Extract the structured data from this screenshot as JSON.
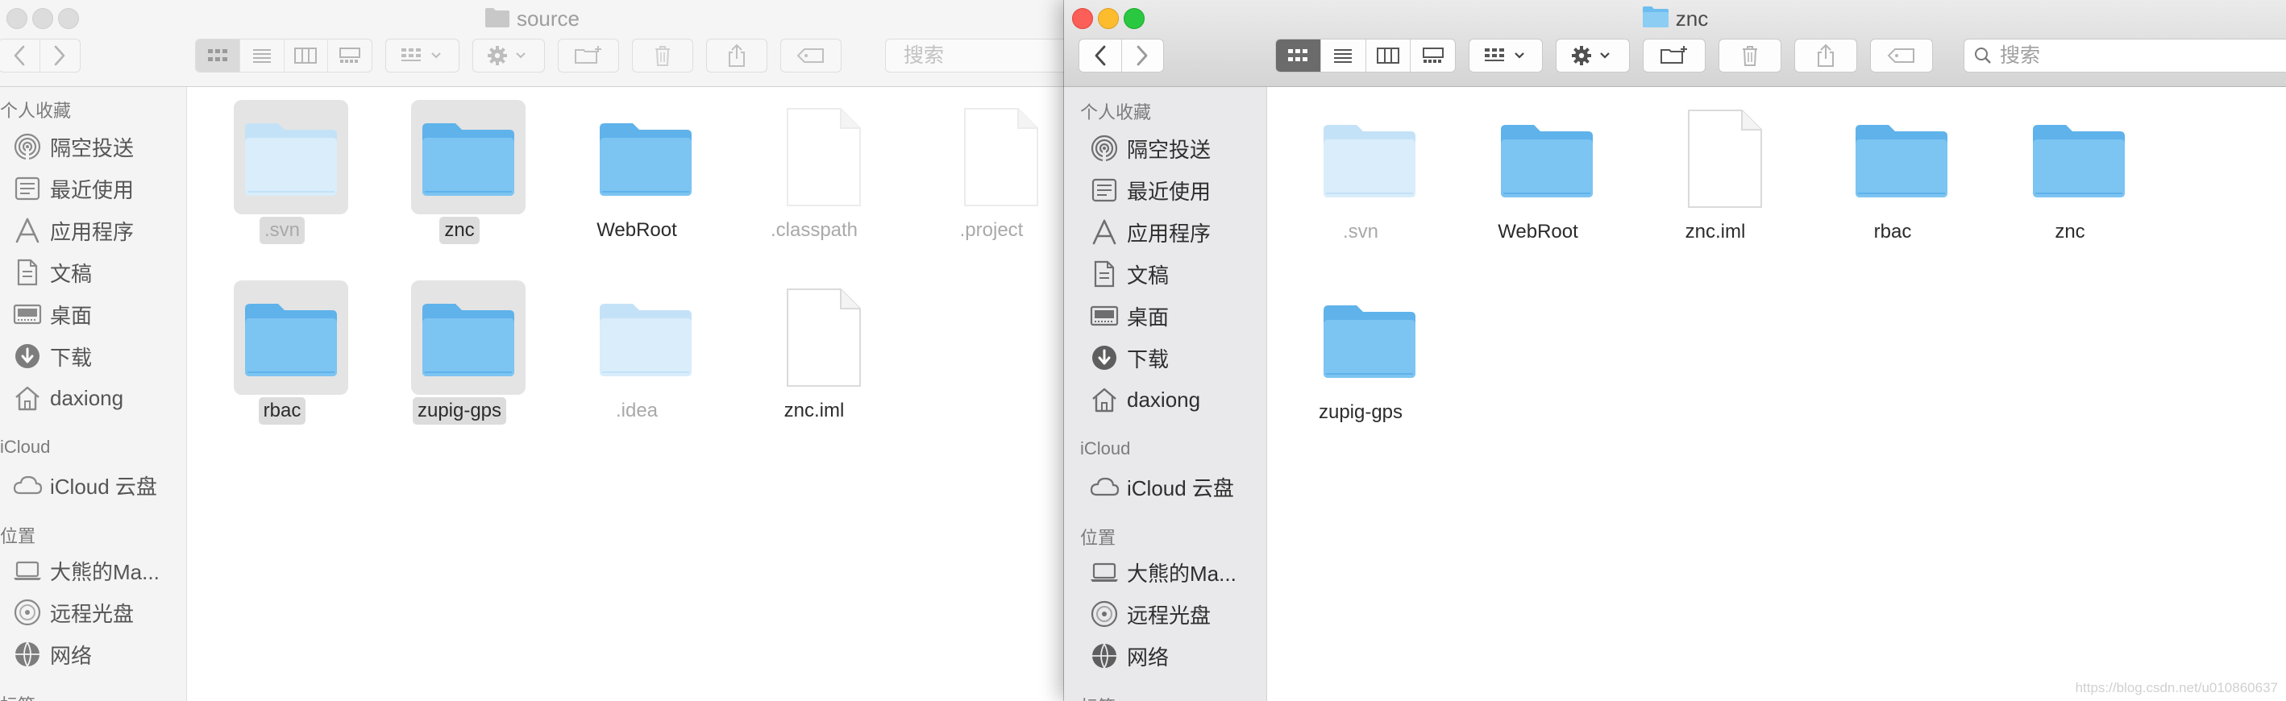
{
  "left_window": {
    "title": "source",
    "search_placeholder": "搜索",
    "sidebar": {
      "favorites_heading": "个人收藏",
      "favorites": [
        {
          "label": "隔空投送",
          "icon": "airdrop-icon"
        },
        {
          "label": "最近使用",
          "icon": "recents-icon"
        },
        {
          "label": "应用程序",
          "icon": "applications-icon"
        },
        {
          "label": "文稿",
          "icon": "documents-icon"
        },
        {
          "label": "桌面",
          "icon": "desktop-icon"
        },
        {
          "label": "下载",
          "icon": "downloads-icon"
        },
        {
          "label": "daxiong",
          "icon": "home-icon"
        }
      ],
      "icloud_heading": "iCloud",
      "icloud": [
        {
          "label": "iCloud 云盘",
          "icon": "cloud-icon"
        }
      ],
      "locations_heading": "位置",
      "locations": [
        {
          "label": "大熊的Ma...",
          "icon": "laptop-icon"
        },
        {
          "label": "远程光盘",
          "icon": "disc-icon"
        },
        {
          "label": "网络",
          "icon": "network-icon"
        }
      ],
      "tags_heading": "标签"
    },
    "files": [
      {
        "name": ".svn",
        "kind": "folder",
        "hidden": true,
        "selected": true
      },
      {
        "name": "znc",
        "kind": "folder",
        "hidden": false,
        "selected": true
      },
      {
        "name": "WebRoot",
        "kind": "folder",
        "hidden": false,
        "selected": false
      },
      {
        "name": ".classpath",
        "kind": "document",
        "hidden": true,
        "selected": false
      },
      {
        "name": ".project",
        "kind": "document",
        "hidden": true,
        "selected": false
      },
      {
        "name": "rbac",
        "kind": "folder",
        "hidden": false,
        "selected": true
      },
      {
        "name": "zupig-gps",
        "kind": "folder",
        "hidden": false,
        "selected": true
      },
      {
        "name": ".idea",
        "kind": "folder",
        "hidden": true,
        "selected": false
      },
      {
        "name": "znc.iml",
        "kind": "document",
        "hidden": false,
        "selected": false
      }
    ]
  },
  "right_window": {
    "title": "znc",
    "search_placeholder": "搜索",
    "sidebar": {
      "favorites_heading": "个人收藏",
      "favorites": [
        {
          "label": "隔空投送",
          "icon": "airdrop-icon"
        },
        {
          "label": "最近使用",
          "icon": "recents-icon"
        },
        {
          "label": "应用程序",
          "icon": "applications-icon"
        },
        {
          "label": "文稿",
          "icon": "documents-icon"
        },
        {
          "label": "桌面",
          "icon": "desktop-icon"
        },
        {
          "label": "下载",
          "icon": "downloads-icon"
        },
        {
          "label": "daxiong",
          "icon": "home-icon"
        }
      ],
      "icloud_heading": "iCloud",
      "icloud": [
        {
          "label": "iCloud 云盘",
          "icon": "cloud-icon"
        }
      ],
      "locations_heading": "位置",
      "locations": [
        {
          "label": "大熊的Ma...",
          "icon": "laptop-icon"
        },
        {
          "label": "远程光盘",
          "icon": "disc-icon"
        },
        {
          "label": "网络",
          "icon": "network-icon"
        }
      ],
      "tags_heading": "标签"
    },
    "files": [
      {
        "name": ".svn",
        "kind": "folder",
        "hidden": true,
        "selected": false
      },
      {
        "name": "WebRoot",
        "kind": "folder",
        "hidden": false,
        "selected": false
      },
      {
        "name": "znc.iml",
        "kind": "document",
        "hidden": false,
        "selected": false
      },
      {
        "name": "rbac",
        "kind": "folder",
        "hidden": false,
        "selected": false
      },
      {
        "name": "znc",
        "kind": "folder",
        "hidden": false,
        "selected": false
      },
      {
        "name": "zupig-gps",
        "kind": "folder",
        "hidden": false,
        "selected": false
      }
    ]
  },
  "toolbar_icons": [
    "back-icon",
    "forward-icon",
    "icon-view-icon",
    "list-view-icon",
    "column-view-icon",
    "gallery-view-icon",
    "group-icon",
    "gear-icon",
    "new-folder-icon",
    "trash-icon",
    "share-icon",
    "tag-icon",
    "search-icon"
  ],
  "watermark": "https://blog.csdn.net/u010860637",
  "colors": {
    "folder": "#6dbdf0",
    "folder_hidden": "#cfe8f9",
    "close": "#fc5f57",
    "minimize": "#fdbc2e",
    "maximize": "#29c840",
    "active_segment": "#6b6b6b"
  }
}
